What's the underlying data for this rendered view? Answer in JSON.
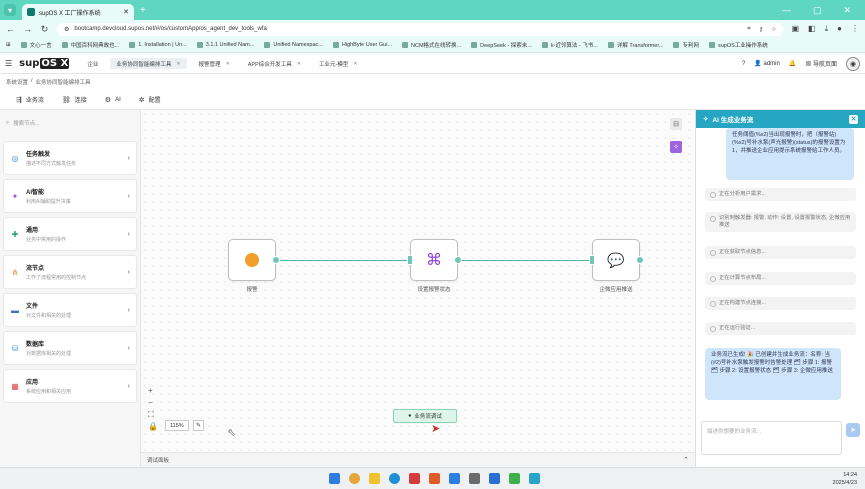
{
  "browser": {
    "tab_title": "supOS X 工厂操作系统",
    "url": "bootcamp.devcloud.supos.net/#/os/customApp/os_agent_dev_tools_wfa",
    "bookmarks": [
      "文心一言",
      "中国百科网典故也...",
      "1. Installation | Un...",
      "3.1.1 Unified Nam...",
      "Unified Namespac...",
      "HighByte User Gui...",
      "NCM格式在线转换...",
      "DeepSeek - 探索未...",
      "k-近邻算法 - 飞书...",
      "详解 Transformer...",
      "专利网",
      "supOS工业操作系统"
    ]
  },
  "app": {
    "logo": "sup",
    "logo_box": "OS X",
    "tabs": [
      {
        "label": "企业",
        "active": false
      },
      {
        "label": "业务协同智能编排工具",
        "active": true
      },
      {
        "label": "报警管理",
        "active": false
      },
      {
        "label": "APP综合开发工具",
        "active": false
      },
      {
        "label": "工业元-模型",
        "active": false
      }
    ],
    "user": "admin",
    "nav_button": "导航页面",
    "breadcrumb": [
      "系统设置",
      "/",
      "业务协同智能编排工具"
    ]
  },
  "toolbar": {
    "items": [
      {
        "icon": "file-icon",
        "label": "业务流"
      },
      {
        "icon": "link-icon",
        "label": "连接"
      },
      {
        "icon": "robot-icon",
        "label": "AI"
      },
      {
        "icon": "gear-icon",
        "label": "配置"
      }
    ]
  },
  "leftpanel": {
    "search_placeholder": "搜索节点...",
    "nodes": [
      {
        "title": "任务触发",
        "sub": "描述不同方式触发任务",
        "icon": "target-icon",
        "color": "#3b7dd8"
      },
      {
        "title": "AI智能",
        "sub": "利用AI辅助提升决策",
        "icon": "sparkle-icon",
        "color": "#8e5bd8"
      },
      {
        "title": "通用",
        "sub": "业务中常用的操作",
        "icon": "puzzle-icon",
        "color": "#2aa67a"
      },
      {
        "title": "流节点",
        "sub": "工作了流程常用的控制节点",
        "icon": "flow-icon",
        "color": "#e08a2c"
      },
      {
        "title": "文件",
        "sub": "对文件和相关的处理",
        "icon": "folder-icon",
        "color": "#4a6fb5"
      },
      {
        "title": "数据库",
        "sub": "对数据库相关的处理",
        "icon": "database-icon",
        "color": "#3b9bd8"
      },
      {
        "title": "应用",
        "sub": "系统应用和相关应用",
        "icon": "apps-icon",
        "color": "#d84a4a"
      }
    ]
  },
  "flow": {
    "nodes": [
      {
        "label": "报警"
      },
      {
        "label": "设置报警状态"
      },
      {
        "label": "企微应用推送"
      }
    ]
  },
  "canvas": {
    "zoom": "115%",
    "debug_button": "业务流调试",
    "debug_bar": "调试面板"
  },
  "ai": {
    "title": "AI 生成业务流",
    "user_msg": "任务阈值(%x2)当出现报警时，把（报警站)(%x2)号补水泵(声光报警)(status)的报警设置为1，并推送企业应用提示系统报警给工作人员。",
    "steps": [
      "正在分析用户需求...",
      "识别到触发器: 报警, 动作: 设置, 设置报警状态, 企微应用推送",
      "正在获取节点信息...",
      "正在计算节点布局...",
      "正在构建节点连接...",
      "正在运行验证..."
    ],
    "bot_msg": "业务流已生成! 🎉 已创建并生成业务流：名称: 当(#2)号补水泵触发报警时告警处理 🗂 步骤 1: 报警 🗂 步骤 2: 设置报警状态 🗂 步骤 3: 企微应用推送",
    "input_placeholder": "描述你想要的业务流..."
  },
  "taskbar": {
    "time": "14:24",
    "date": "2025/4/23"
  }
}
